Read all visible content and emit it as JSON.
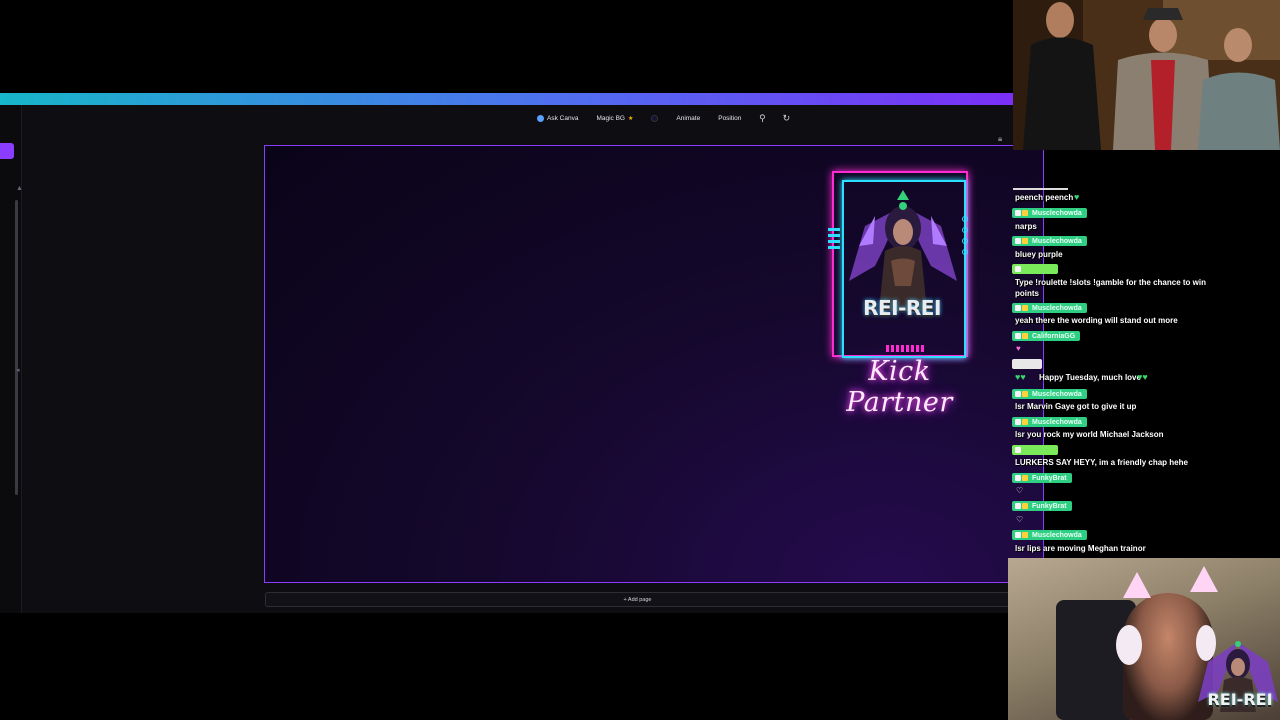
{
  "toolbar": {
    "ask_canva": "Ask Canva",
    "magic_bg": "Magic BG",
    "animate": "Animate",
    "position": "Position"
  },
  "canvas": {
    "add_page": "+ Add page"
  },
  "overlay": {
    "badge_title": "REI-REI",
    "kick_partner": "Kick Partner",
    "corner_logo_title": "REI-REI"
  },
  "chat": {
    "top_message": "peench peench",
    "messages": [
      {
        "user": "Musclechowda",
        "text": "narps"
      },
      {
        "user": "Musclechowda",
        "text": "bluey purple"
      },
      {
        "user": "",
        "text": "Type !roulette !slots !gamble for the chance to win points"
      },
      {
        "user": "Musclechowda",
        "text": "yeah there the wording will stand out more"
      },
      {
        "user": "CaliforniaGG",
        "text": ""
      },
      {
        "user": "",
        "text": "Happy Tuesday, much love"
      },
      {
        "user": "Musclechowda",
        "text": "lsr Marvin Gaye got to give it up"
      },
      {
        "user": "Musclechowda",
        "text": "lsr you rock my world Michael Jackson"
      },
      {
        "user": "",
        "text": "LURKERS SAY HEYY, im a friendly chap hehe"
      },
      {
        "user": "FunkyBrat",
        "text": ""
      },
      {
        "user": "FunkyBrat",
        "text": ""
      },
      {
        "user": "Musclechowda",
        "text": "lsr lips are moving Meghan trainor"
      }
    ]
  },
  "colors": {
    "accent_purple": "#8b3dff",
    "neon_pink": "#ff2bd2",
    "neon_cyan": "#2be0ff",
    "username_green": "#2fcf83"
  }
}
